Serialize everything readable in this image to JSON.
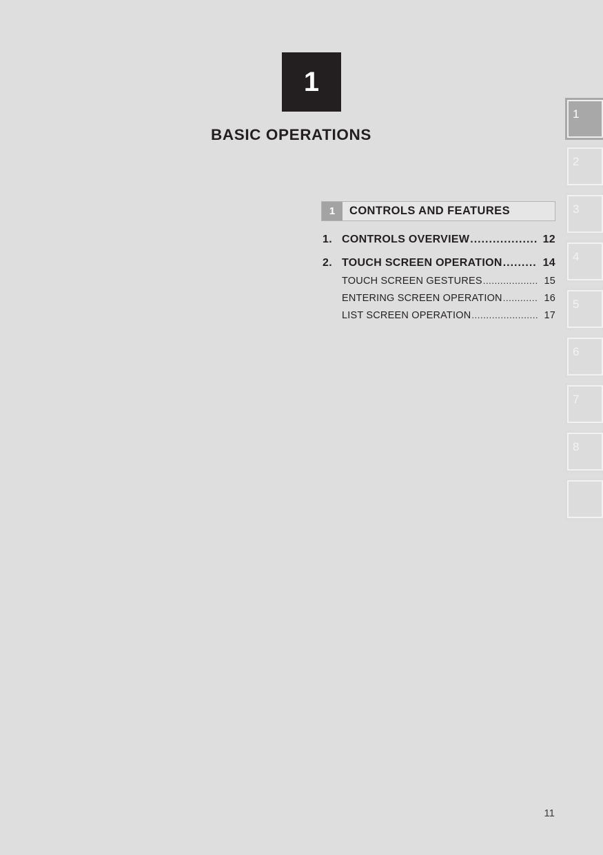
{
  "page": {
    "background_color": "#dedede",
    "page_number": "11"
  },
  "chapter": {
    "badge_number": "1",
    "badge_color": "#231f20",
    "title": "BASIC OPERATIONS"
  },
  "section": {
    "number": "1",
    "title": "CONTROLS AND FEATURES",
    "number_box_color": "#a3a3a3",
    "bar_color": "#e6e6e6"
  },
  "toc": {
    "entries": [
      {
        "level": 1,
        "number": "1.",
        "title": "CONTROLS OVERVIEW",
        "page": "12"
      },
      {
        "level": 1,
        "number": "2.",
        "title": "TOUCH SCREEN OPERATION",
        "page": "14"
      },
      {
        "level": 2,
        "number": "",
        "title": "TOUCH SCREEN GESTURES",
        "page": "15"
      },
      {
        "level": 2,
        "number": "",
        "title": "ENTERING SCREEN OPERATION",
        "page": "16"
      },
      {
        "level": 2,
        "number": "",
        "title": "LIST SCREEN OPERATION",
        "page": "17"
      }
    ]
  },
  "side_tabs": {
    "active_index": 0,
    "active_color": "#a8a8a8",
    "inactive_color": "#dcdcdc",
    "items": [
      {
        "label": "1",
        "active": true
      },
      {
        "label": "2",
        "active": false
      },
      {
        "label": "3",
        "active": false
      },
      {
        "label": "4",
        "active": false
      },
      {
        "label": "5",
        "active": false
      },
      {
        "label": "6",
        "active": false
      },
      {
        "label": "7",
        "active": false
      },
      {
        "label": "8",
        "active": false
      },
      {
        "label": "",
        "active": false
      }
    ]
  }
}
